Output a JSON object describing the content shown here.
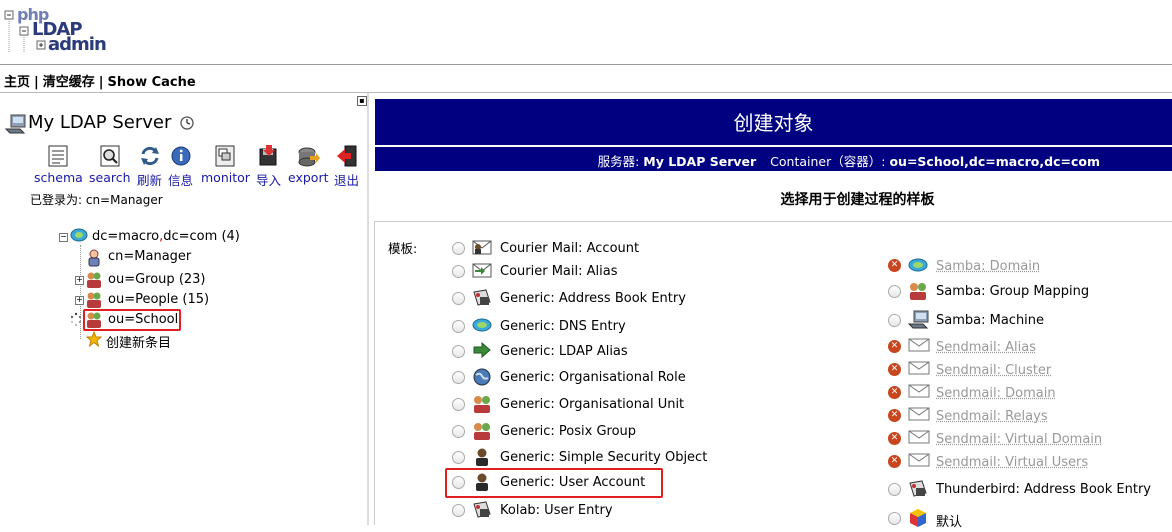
{
  "logo": {
    "line1": "php",
    "line2": "LDAP",
    "line3": "admin"
  },
  "top_links": [
    {
      "label": "主页"
    },
    {
      "label": "清空缓存"
    },
    {
      "label": "Show Cache"
    }
  ],
  "top_link_separator": "|",
  "sidebar": {
    "collapse": "▪",
    "server_name": "My LDAP Server",
    "tools": [
      {
        "label": "schema",
        "icon": "schema-icon"
      },
      {
        "label": "search",
        "icon": "search-icon"
      },
      {
        "label": "刷新",
        "icon": "refresh-icon"
      },
      {
        "label": "信息",
        "icon": "info-icon"
      },
      {
        "label": "monitor",
        "icon": "monitor-icon"
      },
      {
        "label": "导入",
        "icon": "import-icon"
      },
      {
        "label": "export",
        "icon": "export-icon"
      },
      {
        "label": "退出",
        "icon": "logout-icon"
      }
    ],
    "logged_in": "已登录为: cn=Manager",
    "tree": {
      "root": {
        "label": "dc=macro",
        "sep": ",",
        "label2": "dc=com",
        "count": "(4)"
      },
      "children": [
        {
          "label": "cn=Manager",
          "count": ""
        },
        {
          "label": "ou=Group",
          "count": "(23)"
        },
        {
          "label": "ou=People",
          "count": "(15)"
        },
        {
          "label": "ou=School",
          "count": ""
        },
        {
          "label": "创建新条目",
          "count": ""
        }
      ]
    }
  },
  "main": {
    "title": "创建对象",
    "server_label": "服务器:",
    "server_name": "My LDAP Server",
    "container_label": "Container（容器）:",
    "container_value": "ou=School,dc=macro,dc=com",
    "choose_heading": "选择用于创建过程的样板",
    "template_label": "模板:",
    "left_templates": [
      {
        "label": "Courier Mail: Account",
        "icon": "mail-account-icon"
      },
      {
        "label": "Courier Mail: Alias",
        "icon": "mail-alias-icon"
      },
      {
        "label": "Generic: Address Book Entry",
        "icon": "address-book-icon"
      },
      {
        "label": "Generic: DNS Entry",
        "icon": "dns-icon"
      },
      {
        "label": "Generic: LDAP Alias",
        "icon": "alias-arrow-icon"
      },
      {
        "label": "Generic: Organisational Role",
        "icon": "globe-icon"
      },
      {
        "label": "Generic: Organisational Unit",
        "icon": "ou-icon"
      },
      {
        "label": "Generic: Posix Group",
        "icon": "group-icon"
      },
      {
        "label": "Generic: Simple Security Object",
        "icon": "user-icon"
      },
      {
        "label": "Generic: User Account",
        "icon": "user-icon"
      },
      {
        "label": "Kolab: User Entry",
        "icon": "address-book-icon"
      }
    ],
    "right_templates": [
      {
        "label": "Samba: Domain",
        "icon": "dns-icon",
        "disabled": true
      },
      {
        "label": "Samba: Group Mapping",
        "icon": "group-icon",
        "disabled": false
      },
      {
        "label": "Samba: Machine",
        "icon": "server-icon",
        "disabled": false
      },
      {
        "label": "Sendmail: Alias",
        "icon": "envelope-icon",
        "disabled": true
      },
      {
        "label": "Sendmail: Cluster",
        "icon": "envelope-icon",
        "disabled": true
      },
      {
        "label": "Sendmail: Domain",
        "icon": "envelope-icon",
        "disabled": true
      },
      {
        "label": "Sendmail: Relays",
        "icon": "envelope-icon",
        "disabled": true
      },
      {
        "label": "Sendmail: Virtual Domain",
        "icon": "envelope-icon",
        "disabled": true
      },
      {
        "label": "Sendmail: Virtual Users",
        "icon": "envelope-icon",
        "disabled": true
      },
      {
        "label": "Thunderbird: Address Book Entry",
        "icon": "address-book-icon",
        "disabled": false
      },
      {
        "label": "默认",
        "icon": "default-icon",
        "disabled": false
      }
    ],
    "disabled_mark": "✕"
  }
}
